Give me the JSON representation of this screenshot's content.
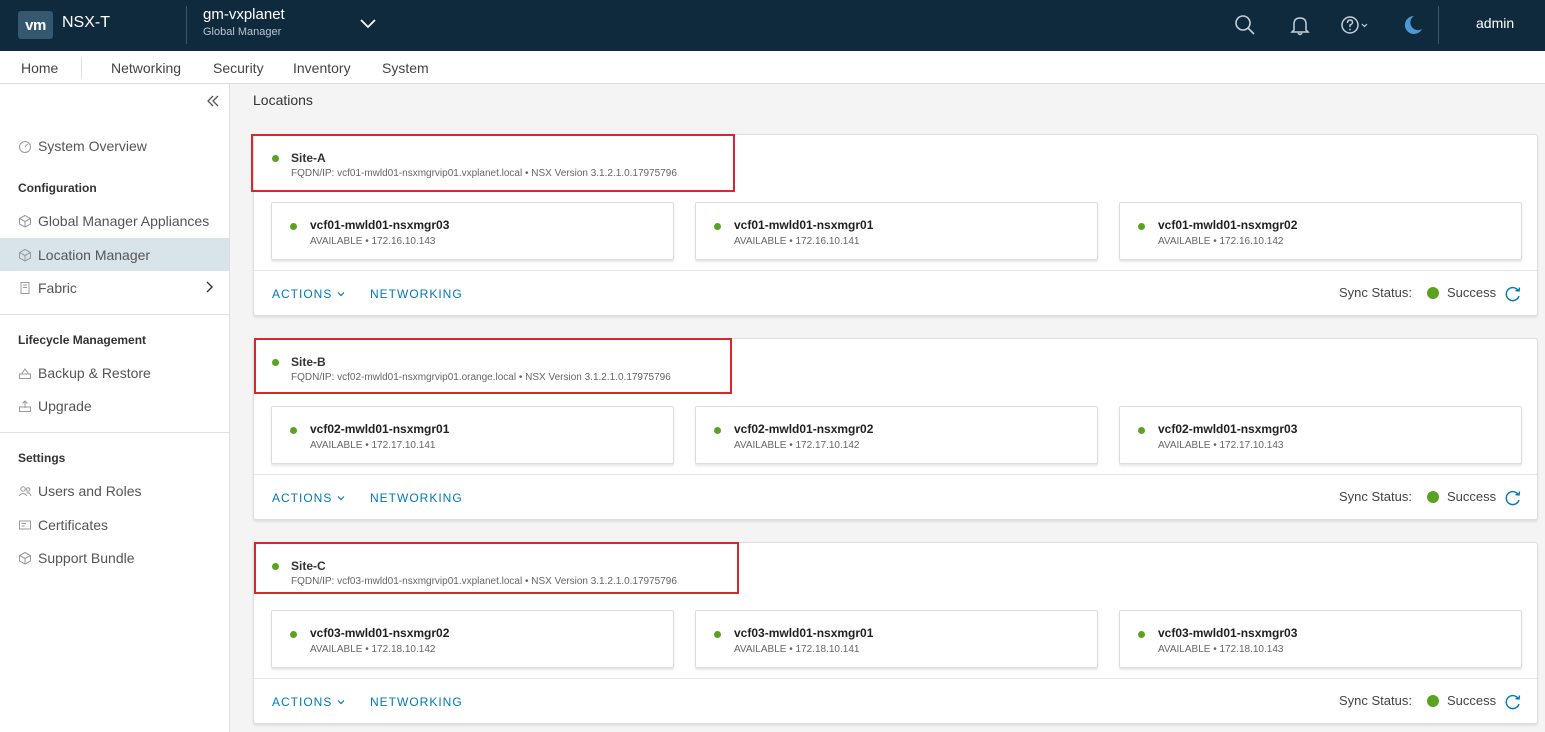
{
  "header": {
    "logo": "vm",
    "product": "NSX-T",
    "context_name": "gm-vxplanet",
    "context_sub": "Global Manager",
    "user": "admin"
  },
  "nav": [
    "Home",
    "Networking",
    "Security",
    "Inventory",
    "System"
  ],
  "sidebar": {
    "system_overview": "System Overview",
    "configuration": "Configuration",
    "gm_appliances": "Global Manager Appliances",
    "location_manager": "Location Manager",
    "fabric": "Fabric",
    "lifecycle": "Lifecycle Management",
    "backup": "Backup & Restore",
    "upgrade": "Upgrade",
    "settings": "Settings",
    "users": "Users and Roles",
    "certs": "Certificates",
    "support": "Support Bundle"
  },
  "page_title": "Locations",
  "labels": {
    "actions": "ACTIONS",
    "networking": "NETWORKING",
    "sync_status": "Sync Status:"
  },
  "sites": [
    {
      "name": "Site-A",
      "meta": "FQDN/IP: vcf01-mwld01-nsxmgrvip01.vxplanet.local • NSX Version 3.1.2.1.0.17975796",
      "sync": "Success",
      "managers": [
        {
          "name": "vcf01-mwld01-nsxmgr03",
          "status": "AVAILABLE • 172.16.10.143"
        },
        {
          "name": "vcf01-mwld01-nsxmgr01",
          "status": "AVAILABLE • 172.16.10.141"
        },
        {
          "name": "vcf01-mwld01-nsxmgr02",
          "status": "AVAILABLE • 172.16.10.142"
        }
      ]
    },
    {
      "name": "Site-B",
      "meta": "FQDN/IP: vcf02-mwld01-nsxmgrvip01.orange.local • NSX Version 3.1.2.1.0.17975796",
      "sync": "Success",
      "managers": [
        {
          "name": "vcf02-mwld01-nsxmgr01",
          "status": "AVAILABLE • 172.17.10.141"
        },
        {
          "name": "vcf02-mwld01-nsxmgr02",
          "status": "AVAILABLE • 172.17.10.142"
        },
        {
          "name": "vcf02-mwld01-nsxmgr03",
          "status": "AVAILABLE • 172.17.10.143"
        }
      ]
    },
    {
      "name": "Site-C",
      "meta": "FQDN/IP: vcf03-mwld01-nsxmgrvip01.vxplanet.local • NSX Version 3.1.2.1.0.17975796",
      "sync": "Success",
      "managers": [
        {
          "name": "vcf03-mwld01-nsxmgr02",
          "status": "AVAILABLE • 172.18.10.142"
        },
        {
          "name": "vcf03-mwld01-nsxmgr01",
          "status": "AVAILABLE • 172.18.10.141"
        },
        {
          "name": "vcf03-mwld01-nsxmgr03",
          "status": "AVAILABLE • 172.18.10.143"
        }
      ]
    }
  ],
  "colors": {
    "header_bg": "#0f2a3d",
    "accent": "#0079b8",
    "success": "#5aa220",
    "highlight": "#d9272e",
    "active_bg": "#d9e4ea"
  },
  "icons": [
    "search-icon",
    "bell-icon",
    "help-icon",
    "moon-icon",
    "refresh-icon",
    "chevron-down-icon",
    "collapse-icon"
  ]
}
